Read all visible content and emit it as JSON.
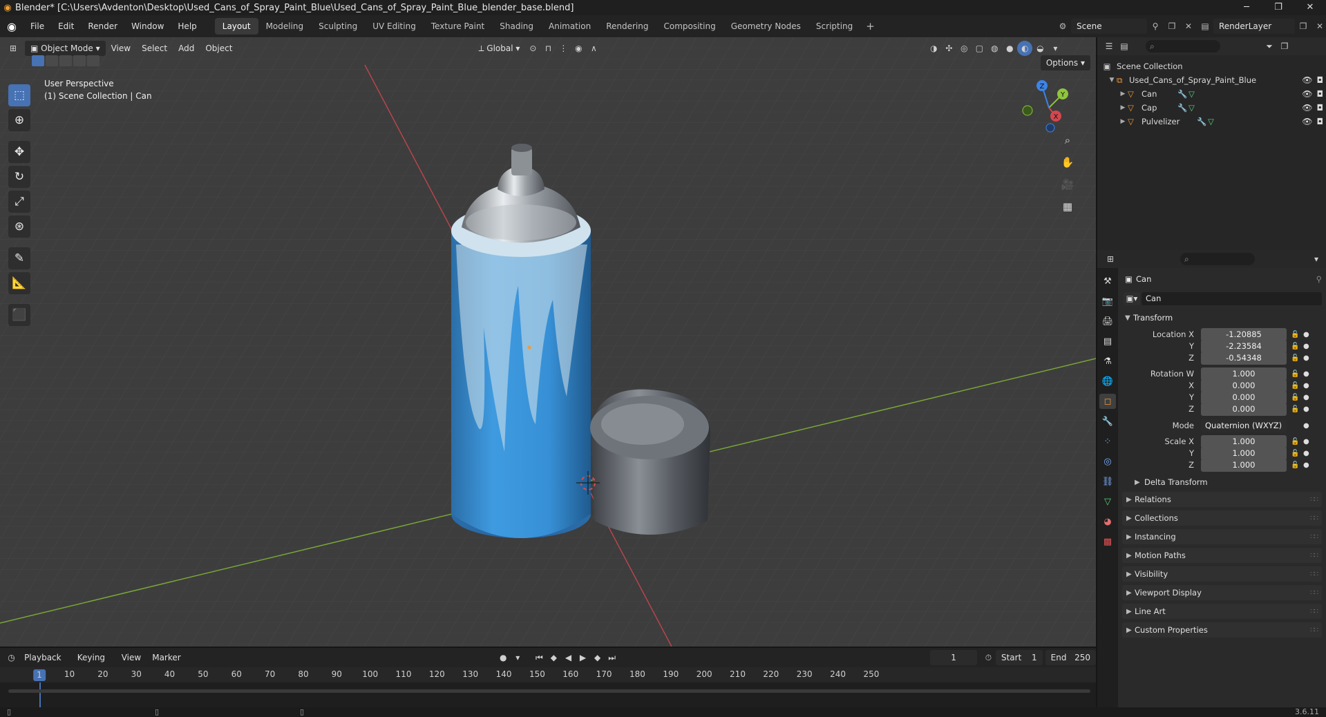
{
  "window": {
    "title": "Blender* [C:\\Users\\Avdenton\\Desktop\\Used_Cans_of_Spray_Paint_Blue\\Used_Cans_of_Spray_Paint_Blue_blender_base.blend]",
    "minimize": "─",
    "maximize": "❐",
    "close": "✕"
  },
  "menubar": {
    "menus": [
      "File",
      "Edit",
      "Render",
      "Window",
      "Help"
    ],
    "workspaces": [
      "Layout",
      "Modeling",
      "Sculpting",
      "UV Editing",
      "Texture Paint",
      "Shading",
      "Animation",
      "Rendering",
      "Compositing",
      "Geometry Nodes",
      "Scripting"
    ],
    "active_workspace": "Layout",
    "add_workspace": "+",
    "scene": "Scene",
    "view_layer": "RenderLayer"
  },
  "viewport": {
    "mode": "Object Mode",
    "menus": [
      "View",
      "Select",
      "Add",
      "Object"
    ],
    "orientation": "Global",
    "options": "Options",
    "perspective_label": "User Perspective",
    "context_label": "(1) Scene Collection | Can",
    "gizmo_axes": {
      "x": "X",
      "y": "Y",
      "z": "Z"
    }
  },
  "outliner": {
    "root": "Scene Collection",
    "collection": "Used_Cans_of_Spray_Paint_Blue",
    "objects": [
      "Can",
      "Cap",
      "Pulvelizer"
    ]
  },
  "properties": {
    "object_name": "Can",
    "datablock_name": "Can",
    "transform": {
      "title": "Transform",
      "location_label": "Location X",
      "location": [
        "-1.20885",
        "-2.23584",
        "-0.54348"
      ],
      "rotation_label": "Rotation W",
      "rotation": [
        "1.000",
        "0.000",
        "0.000",
        "0.000"
      ],
      "mode_label": "Mode",
      "mode": "Quaternion (WXYZ)",
      "scale_label": "Scale X",
      "scale": [
        "1.000",
        "1.000",
        "1.000"
      ],
      "axis_y": "Y",
      "axis_z": "Z",
      "axis_x": "X",
      "delta": "Delta Transform"
    },
    "panels": [
      "Relations",
      "Collections",
      "Instancing",
      "Motion Paths",
      "Visibility",
      "Viewport Display",
      "Line Art",
      "Custom Properties"
    ]
  },
  "timeline": {
    "menus": [
      "Playback",
      "Keying",
      "View",
      "Marker"
    ],
    "current_frame": "1",
    "start_label": "Start",
    "start": "1",
    "end_label": "End",
    "end": "250",
    "ruler": [
      "10",
      "20",
      "30",
      "40",
      "50",
      "60",
      "70",
      "80",
      "90",
      "100",
      "110",
      "120",
      "130",
      "140",
      "150",
      "160",
      "170",
      "180",
      "190",
      "200",
      "210",
      "220",
      "230",
      "240",
      "250"
    ],
    "cursor": "1"
  },
  "status": {
    "version": "3.6.11"
  },
  "colors": {
    "accent": "#4772b3",
    "object_orange": "#f09a3a",
    "x_axis": "#d4474f",
    "y_axis": "#8fc43d",
    "z_axis": "#3d84e6"
  }
}
